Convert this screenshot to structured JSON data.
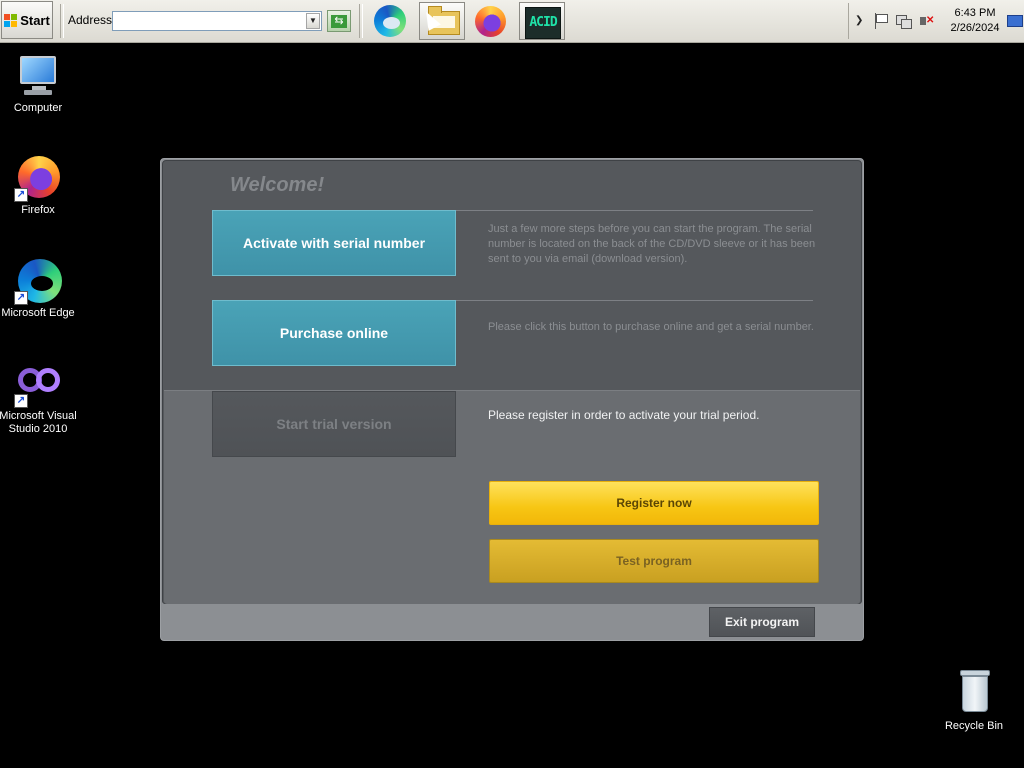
{
  "taskbar": {
    "start_label": "Start",
    "address_label": "Address",
    "address_value": "",
    "apps": [
      {
        "name": "Microsoft Edge",
        "icon": "edge-icon"
      },
      {
        "name": "File Explorer",
        "icon": "folder-icon"
      },
      {
        "name": "Firefox",
        "icon": "firefox-icon"
      },
      {
        "name": "ACID",
        "icon": "acid-icon",
        "label": "ACID"
      }
    ],
    "tray": {
      "time": "6:43 PM",
      "date": "2/26/2024"
    }
  },
  "desktop": {
    "icons": [
      {
        "label": "Computer",
        "icon": "computer-icon"
      },
      {
        "label": "Firefox",
        "icon": "firefox-icon"
      },
      {
        "label": "Microsoft Edge",
        "icon": "edge-icon"
      },
      {
        "label": "Microsoft Visual Studio 2010",
        "icon": "visual-studio-icon"
      },
      {
        "label": "Recycle Bin",
        "icon": "recycle-bin-icon"
      }
    ]
  },
  "dialog": {
    "title": "Welcome!",
    "activate": {
      "button": "Activate with serial number",
      "description": "Just a few more steps before you can start the program. The serial number is located on the back of the CD/DVD sleeve or it has been sent to you via email (download version)."
    },
    "purchase": {
      "button": "Purchase online",
      "description": "Please click this button to purchase online and get a serial number."
    },
    "trial": {
      "button": "Start trial version",
      "description": "Please register in order to activate your trial period.",
      "register_button": "Register now",
      "test_button": "Test program"
    },
    "exit_button": "Exit program"
  },
  "colors": {
    "teal_button": "#4aa3b7",
    "yellow_button": "#f7c614",
    "panel_dark": "#55585c",
    "panel_light": "#6a6d71"
  }
}
